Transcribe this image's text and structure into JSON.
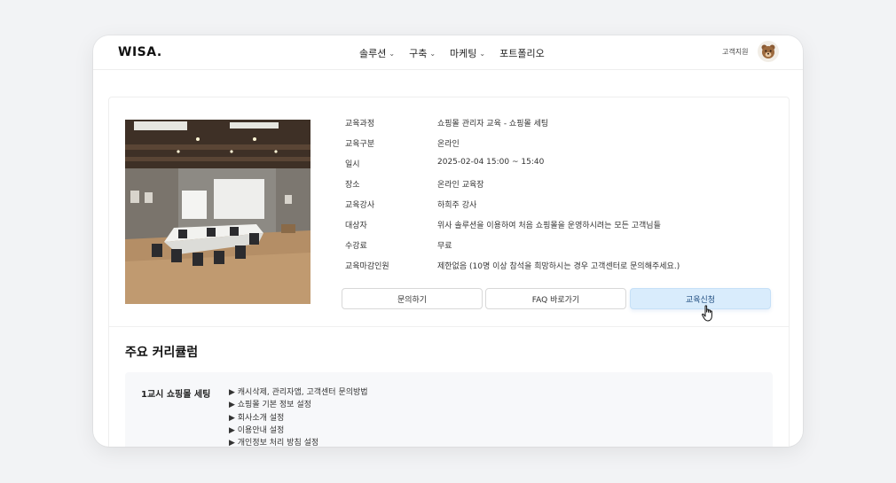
{
  "header": {
    "logo": "WISA.",
    "nav": [
      "솔루션",
      "구축",
      "마케팅",
      "포트폴리오"
    ],
    "support_link": "고객지원"
  },
  "course": {
    "rows": [
      {
        "label": "교육과정",
        "value": "쇼핑몰 관리자 교육 - 쇼핑몰 세팅"
      },
      {
        "label": "교육구분",
        "value": "온라인"
      },
      {
        "label": "일시",
        "value": "2025-02-04 15:00 ~ 15:40"
      },
      {
        "label": "장소",
        "value": "온라인 교육장"
      },
      {
        "label": "교육강사",
        "value": "하희주 강사"
      },
      {
        "label": "대상자",
        "value": "위사 솔루션을 이용하여 처음 쇼핑몰을 운영하시려는 모든 고객님들"
      },
      {
        "label": "수강료",
        "value": "무료"
      },
      {
        "label": "교육마감인원",
        "value": "제한없음 (10명 이상 참석을 희망하시는 경우 고객센터로 문의해주세요.)"
      }
    ],
    "buttons": {
      "inquiry": "문의하기",
      "faq": "FAQ 바로가기",
      "apply": "교육신청"
    }
  },
  "curriculum": {
    "title": "주요 커리큘럼",
    "session": "1교시 쇼핑몰 세팅",
    "topics": [
      "▶ 캐시삭제, 관리자앱, 고객센터 문의방법",
      "▶ 쇼핑몰 기본 정보 설정",
      "▶ 회사소개 설정",
      "▶ 이용안내 설정",
      "▶ 개인정보 처리 방침 설정"
    ]
  },
  "colors": {
    "accent_button_bg": "#d9ecfc",
    "page_bg": "#f2f3f5"
  },
  "icons": [
    "chevron-down-icon",
    "bear-avatar-icon",
    "hand-pointer-cursor-icon"
  ]
}
